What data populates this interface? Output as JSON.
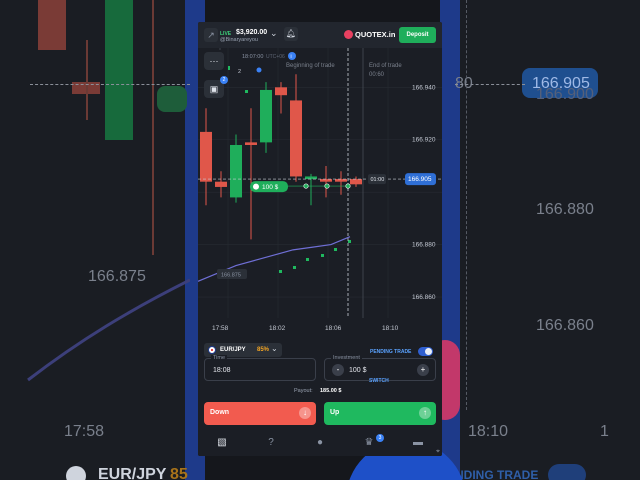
{
  "background": {
    "price_top": "166.905",
    "price_left_partial": "80",
    "prices_right": [
      "166.880",
      "166.860"
    ],
    "price_left": "166.875",
    "time_left": "17:58",
    "time_right": "18:10",
    "time_far_right": "1",
    "pair_left": "EUR/JPY",
    "pct_left": "85",
    "pending_right": "NDING TRADE",
    "top_right_price": "166.900"
  },
  "header": {
    "live_label": "LIVE",
    "balance": "$3,920.00",
    "username": "@Binaryareyou",
    "brand": "QUOTEX.in",
    "deposit_label": "Deposit"
  },
  "chart": {
    "time_label": "18:07:00",
    "utc_label": "UTC+06",
    "beginning_label": "Beginning of trade",
    "end_label": "End of trade",
    "end_time": "00:60",
    "timer": "01:00",
    "current_price": "166.905",
    "amount_tag": "100 $",
    "indicator_value": "166.875",
    "counter": "2",
    "price_axis": [
      "166.940",
      "166.920",
      "166.880",
      "166.860"
    ],
    "time_axis": [
      "17:58",
      "18:02",
      "18:06",
      "18:10"
    ]
  },
  "chart_data": {
    "type": "candlestick",
    "candles": [
      {
        "o": 166.923,
        "c": 166.904,
        "h": 166.932,
        "l": 166.895,
        "dir": "down"
      },
      {
        "o": 166.904,
        "c": 166.902,
        "h": 166.908,
        "l": 166.898,
        "dir": "down"
      },
      {
        "o": 166.898,
        "c": 166.918,
        "h": 166.922,
        "l": 166.896,
        "dir": "up"
      },
      {
        "o": 166.918,
        "c": 166.919,
        "h": 166.932,
        "l": 166.882,
        "dir": "down"
      },
      {
        "o": 166.919,
        "c": 166.939,
        "h": 166.942,
        "l": 166.915,
        "dir": "up"
      },
      {
        "o": 166.94,
        "c": 166.937,
        "h": 166.942,
        "l": 166.93,
        "dir": "down"
      },
      {
        "o": 166.935,
        "c": 166.906,
        "h": 166.945,
        "l": 166.904,
        "dir": "down"
      },
      {
        "o": 166.906,
        "c": 166.905,
        "h": 166.907,
        "l": 166.895,
        "dir": "up"
      },
      {
        "o": 166.905,
        "c": 166.904,
        "h": 166.91,
        "l": 166.898,
        "dir": "down"
      },
      {
        "o": 166.905,
        "c": 166.904,
        "h": 166.908,
        "l": 166.899,
        "dir": "down"
      },
      {
        "o": 166.905,
        "c": 166.903,
        "h": 166.906,
        "l": 166.902,
        "dir": "down"
      }
    ],
    "indicator": [
      166.866,
      166.869,
      166.872,
      166.874,
      166.876,
      166.878,
      166.879,
      166.88,
      166.883
    ],
    "ylim": [
      166.852,
      166.955
    ],
    "current_price": 166.905
  },
  "pair": {
    "name": "EUR/JPY",
    "percent": "85%",
    "pending_label": "PENDING TRADE"
  },
  "time_field": {
    "label": "Time",
    "value": "18:08"
  },
  "investment_field": {
    "label": "Investment",
    "value": "100 $",
    "switch_label": "SWITCH",
    "minus": "-",
    "plus": "+"
  },
  "payout": {
    "label": "Payout:",
    "value": "185.00 $"
  },
  "trade": {
    "down_label": "Down",
    "up_label": "Up"
  },
  "nav": {
    "badge": "3"
  },
  "colors": {
    "up": "#1fae5b",
    "down": "#e0574a",
    "accent": "#3b82f6",
    "indicator": "#6f6fd6"
  }
}
